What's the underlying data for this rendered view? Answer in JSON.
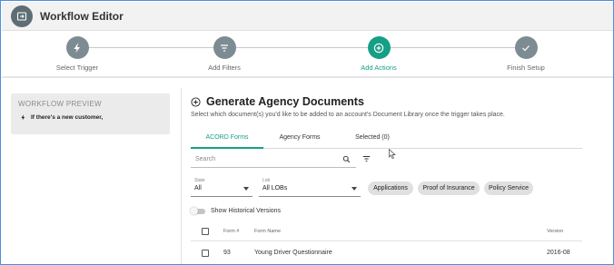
{
  "app": {
    "title": "Workflow Editor",
    "icon": "exit-to-app-icon"
  },
  "stepper": {
    "steps": [
      {
        "label": "Select Trigger",
        "icon": "lightning-bolt-icon",
        "state": "done"
      },
      {
        "label": "Add Filters",
        "icon": "filter-icon",
        "state": "done"
      },
      {
        "label": "Add Actions",
        "icon": "plus-circle-icon",
        "state": "active"
      },
      {
        "label": "Finish Setup",
        "icon": "check-icon",
        "state": "pending"
      }
    ],
    "accent": "#159f86",
    "inactive": "#7d8c93"
  },
  "preview": {
    "title": "WORKFLOW PREVIEW",
    "trigger_text": "If there's a new customer,"
  },
  "main": {
    "title": "Generate Agency Documents",
    "description": "Select which document(s) you'd like to be added to an account's Document Library once the trigger takes place."
  },
  "tabs": {
    "items": [
      "ACORD Forms",
      "Agency Forms",
      "Selected (0)"
    ],
    "active_index": 0
  },
  "search": {
    "placeholder": "Search"
  },
  "filters": {
    "state": {
      "label": "State",
      "value": "All"
    },
    "lob": {
      "label": "Lob",
      "value": "All LOBs"
    },
    "chips": [
      "Applications",
      "Proof of Insurance",
      "Policy Service"
    ]
  },
  "toggle": {
    "label": "Show Historical Versions",
    "on": false
  },
  "table": {
    "columns": [
      "Form #",
      "Form Name",
      "Version"
    ],
    "rows": [
      {
        "form_no": "93",
        "form_name": "Young Driver Questionnaire",
        "version": "2016-08"
      }
    ]
  }
}
